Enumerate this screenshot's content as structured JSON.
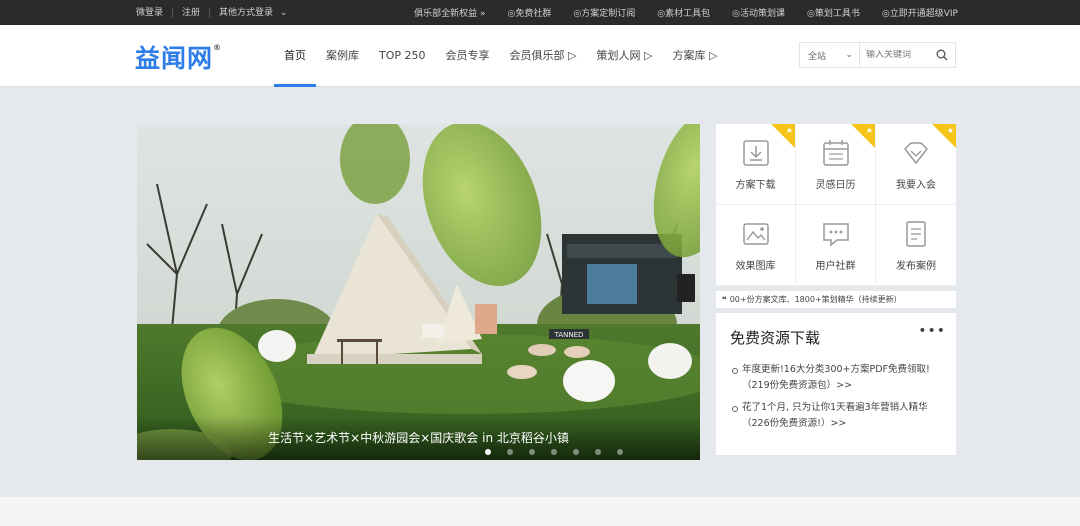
{
  "topbar": {
    "left": [
      "微登录",
      "注册",
      "其他方式登录"
    ],
    "right": [
      "俱乐部全新权益 »",
      "免费社群",
      "方案定制订阅",
      "素材工具包",
      "活动策划课",
      "策划工具书",
      "立即开通超级VIP"
    ]
  },
  "header": {
    "logo": "益闻网",
    "logo_mark": "®",
    "nav": [
      "首页",
      "案例库",
      "TOP 250",
      "会员专享",
      "会员俱乐部 ▷",
      "策划人网 ▷",
      "方案库 ▷"
    ],
    "search": {
      "select": "全站",
      "placeholder": "输入关键词"
    }
  },
  "banner": {
    "caption": "生活节×艺术节×中秋游园会×国庆歌会 in 北京稻谷小镇",
    "slides": 7,
    "active_slide": 1,
    "sign": "TANNED"
  },
  "quick": [
    {
      "label": "方案下载",
      "icon": "download-icon",
      "badge": true
    },
    {
      "label": "灵感日历",
      "icon": "calendar-icon",
      "badge": true
    },
    {
      "label": "我要入会",
      "icon": "diamond-icon",
      "badge": true
    },
    {
      "label": "效果图库",
      "icon": "image-icon",
      "badge": false
    },
    {
      "label": "用户社群",
      "icon": "chat-icon",
      "badge": false
    },
    {
      "label": "发布案例",
      "icon": "document-icon",
      "badge": false
    }
  ],
  "badge_star": "★",
  "strip": {
    "quote": "❝",
    "text": "00+份方案文库、1800+策划精华（持续更新）"
  },
  "free": {
    "title": "免费资源下载",
    "more": "•••",
    "items": [
      "年度更新!16大分类300+方案PDF免费领取!（219份免费资源包）>>",
      "花了1个月, 只为让你1天看遍3年营销人精华（226份免费资源!）>>"
    ]
  },
  "colors": {
    "accent": "#2d7de8",
    "badge": "#f5c518",
    "topbar": "#2b2b2b"
  }
}
